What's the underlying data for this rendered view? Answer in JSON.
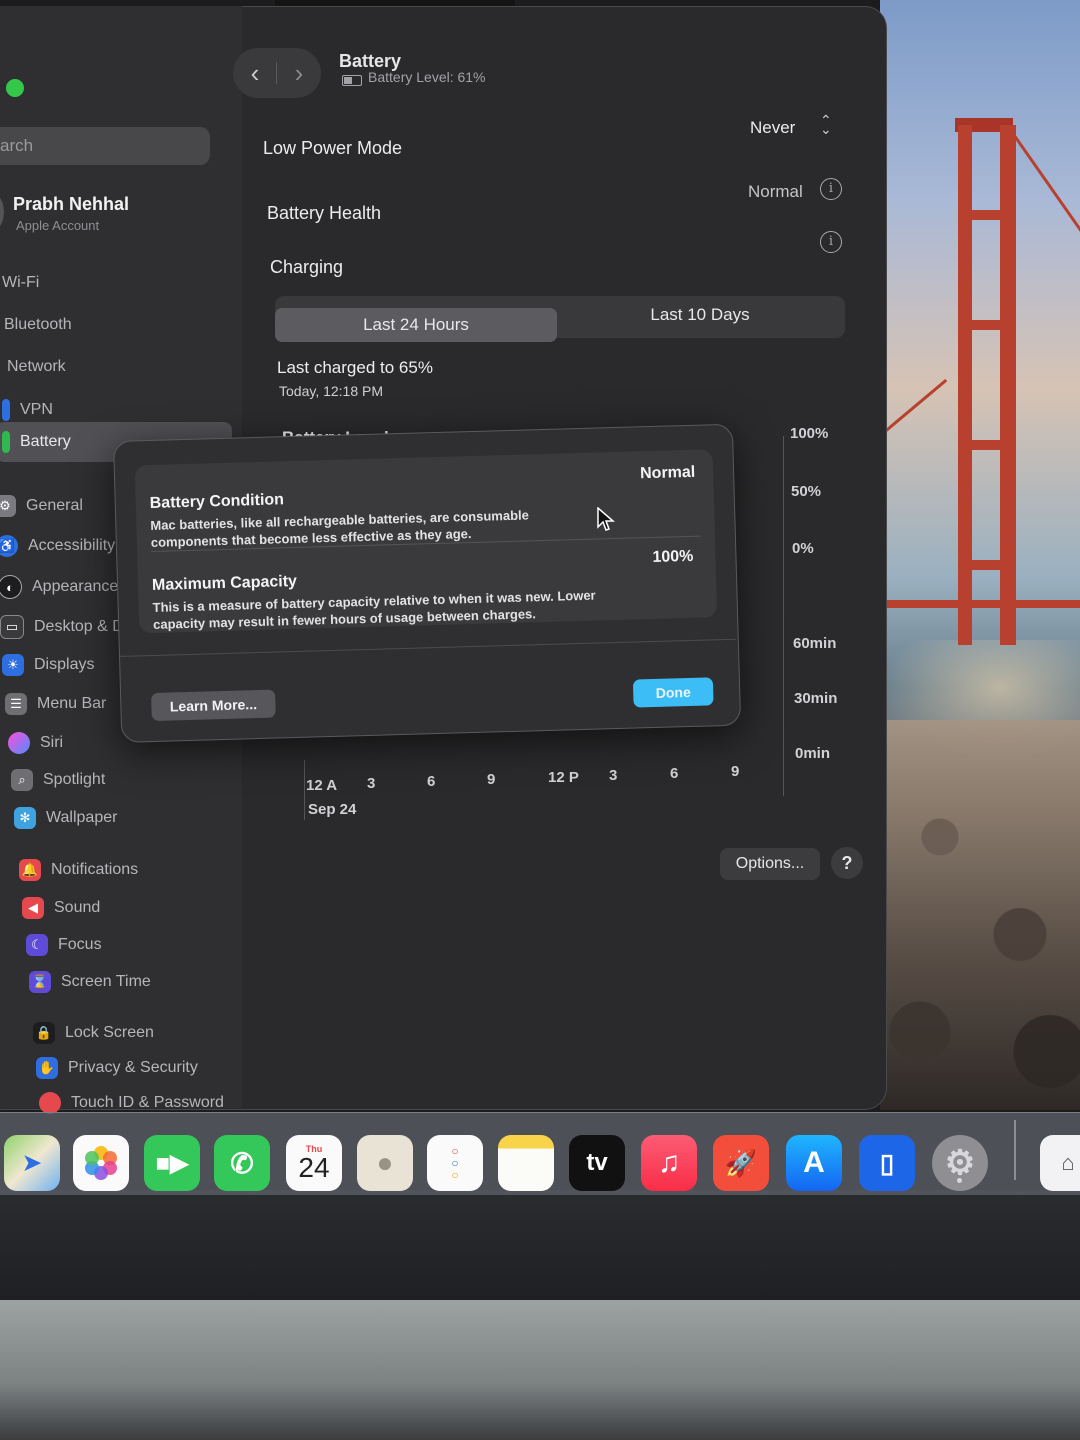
{
  "window": {
    "title": "Battery",
    "subtitle": "Battery Level: 61%"
  },
  "sidebar": {
    "search_placeholder": "arch",
    "user": {
      "name": "Prabh Nehhal",
      "subtitle": "Apple Account"
    },
    "items": [
      {
        "label": "Wi-Fi",
        "icon": "wifi-icon"
      },
      {
        "label": "Bluetooth",
        "icon": "bluetooth-icon"
      },
      {
        "label": "Network",
        "icon": "network-icon"
      },
      {
        "label": "VPN",
        "icon": "vpn-icon"
      },
      {
        "label": "Battery",
        "icon": "battery-icon",
        "selected": true
      },
      {
        "label": "General",
        "icon": "gear-icon"
      },
      {
        "label": "Accessibility",
        "icon": "accessibility-icon"
      },
      {
        "label": "Appearance",
        "icon": "appearance-icon"
      },
      {
        "label": "Desktop & D",
        "icon": "desktop-dock-icon"
      },
      {
        "label": "Displays",
        "icon": "displays-icon"
      },
      {
        "label": "Menu Bar",
        "icon": "menu-bar-icon"
      },
      {
        "label": "Siri",
        "icon": "siri-icon"
      },
      {
        "label": "Spotlight",
        "icon": "spotlight-icon"
      },
      {
        "label": "Wallpaper",
        "icon": "wallpaper-icon"
      },
      {
        "label": "Notifications",
        "icon": "notifications-icon"
      },
      {
        "label": "Sound",
        "icon": "sound-icon"
      },
      {
        "label": "Focus",
        "icon": "focus-icon"
      },
      {
        "label": "Screen Time",
        "icon": "screen-time-icon"
      },
      {
        "label": "Lock Screen",
        "icon": "lock-icon"
      },
      {
        "label": "Privacy & Security",
        "icon": "privacy-hand-icon"
      },
      {
        "label": "Touch ID & Password",
        "icon": "fingerprint-icon"
      }
    ]
  },
  "settings": {
    "low_power_mode": {
      "label": "Low Power Mode",
      "value": "Never"
    },
    "battery_health": {
      "label": "Battery Health",
      "value": "Normal"
    },
    "charging": {
      "label": "Charging"
    }
  },
  "usage": {
    "tabs": [
      "Last 24 Hours",
      "Last 10 Days"
    ],
    "active_tab": "Last 24 Hours",
    "last_charged": "Last charged to 65%",
    "last_charged_time": "Today, 12:18 PM",
    "battery_level_title": "Battery Level",
    "battery_axis": [
      "100%",
      "50%",
      "0%"
    ],
    "screen_axis": [
      "60min",
      "30min",
      "0min"
    ],
    "x_ticks": [
      "12 A",
      "3",
      "6",
      "9",
      "12 P",
      "3",
      "6",
      "9"
    ],
    "date_label": "Sep 24",
    "options_label": "Options...",
    "help_label": "?"
  },
  "modal": {
    "condition_title": "Battery Condition",
    "condition_text": "Mac batteries, like all rechargeable batteries, are consumable components that become less effective as they age.",
    "condition_value": "Normal",
    "capacity_title": "Maximum Capacity",
    "capacity_text": "This is a measure of battery capacity relative to when it was new. Lower capacity may result in fewer hours of usage between charges.",
    "capacity_value": "100%",
    "learn_more_label": "Learn More...",
    "done_label": "Done"
  },
  "dock": {
    "calendar_day": "Thu",
    "calendar_date": "24",
    "tv_label": "tv",
    "apps": [
      "maps-icon",
      "photos-icon",
      "facetime-icon",
      "phone-icon",
      "calendar-icon",
      "contacts-icon",
      "reminders-icon",
      "notes-icon",
      "apple-tv-icon",
      "music-icon",
      "rocket-app-icon",
      "app-store-icon",
      "blue-app-icon",
      "system-settings-icon",
      "preview-icon"
    ]
  },
  "colors": {
    "accent_done": "#3dbdf5",
    "traffic_green": "#34c84a",
    "window_bg": "#2a2a2c"
  }
}
